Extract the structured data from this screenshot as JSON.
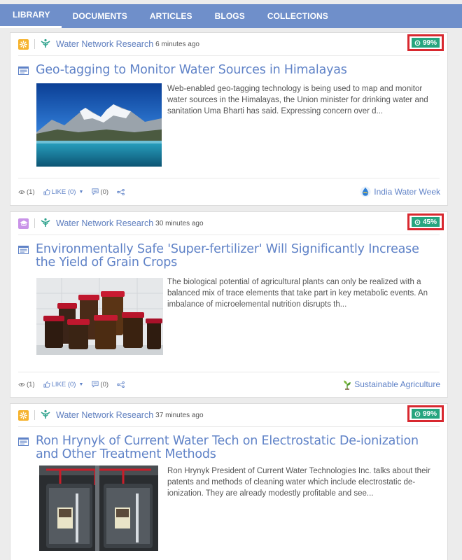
{
  "nav": {
    "tabs": [
      {
        "label": "LIBRARY"
      },
      {
        "label": "DOCUMENTS"
      },
      {
        "label": "ARTICLES"
      },
      {
        "label": "BLOGS"
      },
      {
        "label": "COLLECTIONS"
      }
    ],
    "active": "LIBRARY"
  },
  "colors": {
    "nav": "#6f8fca",
    "link": "#5f82c7",
    "badge": "#26a57f",
    "highlight": "#d8282f"
  },
  "cards": [
    {
      "category_icon": "gear-icon",
      "org": "Water Network Research",
      "time": "6 minutes ago",
      "score": "99%",
      "title": "Geo-tagging to Monitor Water Sources in Himalayas",
      "excerpt": "Web-enabled geo-tagging technology is being used to map and monitor water sources in the Himalayas, the Union minister for drinking water and sanitation Uma Bharti has said. Expressing concern over d...",
      "views": "(1)",
      "like": "LIKE (0)",
      "comments": "(0)",
      "tag": "India Water Week",
      "tag_icon": "water-drop-icon"
    },
    {
      "category_icon": "graduation-cap-icon",
      "org": "Water Network Research",
      "time": "30 minutes ago",
      "score": "45%",
      "title": "Environmentally Safe 'Super-fertilizer' Will Significantly Increase the Yield of Grain Crops",
      "excerpt": "The biological potential of agricultural plants can only be realized with a balanced mix of trace elements that take part in key metabolic events. An imbalance of microelemental nutrition disrupts th...",
      "views": "(1)",
      "like": "LIKE (0)",
      "comments": "(0)",
      "tag": "Sustainable Agriculture",
      "tag_icon": "sprout-icon"
    },
    {
      "category_icon": "gear-icon",
      "org": "Water Network Research",
      "time": "37 minutes ago",
      "score": "99%",
      "title": "Ron Hrynyk of Current Water Tech on Electrostatic De-ionization and Other Treatment Methods",
      "excerpt": "Ron Hrynyk President of Current Water Technologies Inc. talks about their patents and methods of cleaning water which include electrostatic de-ionization. They are already modestly profitable and see..."
    }
  ]
}
